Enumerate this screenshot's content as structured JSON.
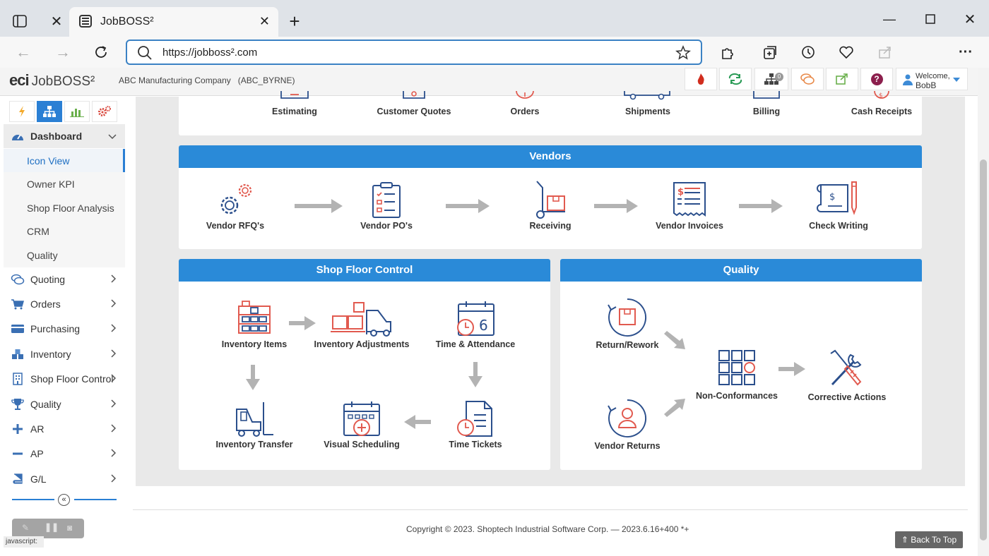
{
  "browser": {
    "tab_title": "JobBOSS²",
    "url": "https://jobboss².com"
  },
  "app": {
    "logo_eci": "eci",
    "logo_product": "JobBOSS²",
    "company": "ABC Manufacturing Company",
    "company_code": "(ABC_BYRNE)",
    "notif_count": "0",
    "welcome_label": "Welcome,",
    "user": "BobB"
  },
  "sidebar": {
    "dashboard": "Dashboard",
    "subitems": [
      "Icon View",
      "Owner KPI",
      "Shop Floor Analysis",
      "CRM",
      "Quality"
    ],
    "items": [
      "Quoting",
      "Orders",
      "Purchasing",
      "Inventory",
      "Shop Floor Control",
      "Quality",
      "AR",
      "AP",
      "G/L"
    ]
  },
  "customers": {
    "modules": [
      "Estimating",
      "Customer Quotes",
      "Orders",
      "Shipments",
      "Billing",
      "Cash Receipts"
    ]
  },
  "vendors": {
    "title": "Vendors",
    "modules": [
      "Vendor RFQ's",
      "Vendor PO's",
      "Receiving",
      "Vendor Invoices",
      "Check Writing"
    ]
  },
  "shopfloor": {
    "title": "Shop Floor Control",
    "inventory_items": "Inventory Items",
    "inventory_adjustments": "Inventory Adjustments",
    "time_attendance": "Time & Attendance",
    "inventory_transfer": "Inventory Transfer",
    "visual_scheduling": "Visual Scheduling",
    "time_tickets": "Time Tickets"
  },
  "quality": {
    "title": "Quality",
    "return_rework": "Return/Rework",
    "vendor_returns": "Vendor Returns",
    "non_conformances": "Non-Conformances",
    "corrective_actions": "Corrective Actions"
  },
  "footer": {
    "copyright": "Copyright © 2023. Shoptech Industrial Software Corp. — 2023.6.16+400 *+",
    "back_to_top": "Back To Top",
    "status": "javascript:"
  },
  "colors": {
    "accent": "#2a8ad8",
    "icon_blue": "#2b4f8c",
    "icon_red": "#e15a4f",
    "arrow_grey": "#b3b3b3"
  }
}
